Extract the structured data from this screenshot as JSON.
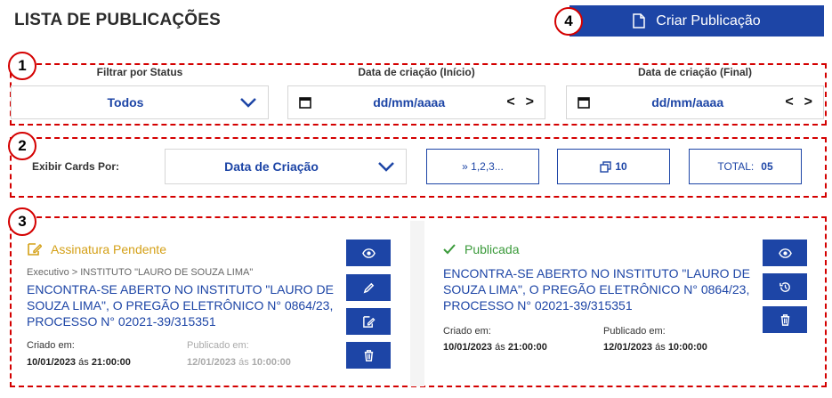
{
  "header": {
    "title": "LISTA DE PUBLICAÇÕES",
    "create_button": "Criar Publicação"
  },
  "callouts": [
    "1",
    "2",
    "3",
    "4"
  ],
  "filters": {
    "status_label": "Filtrar por Status",
    "status_value": "Todos",
    "start_label": "Data de criação (Início)",
    "start_placeholder": "dd/mm/aaaa",
    "end_label": "Data de criação (Final)",
    "end_placeholder": "dd/mm/aaaa",
    "prev_symbol": "<",
    "next_symbol": ">"
  },
  "display": {
    "label": "Exibir Cards Por:",
    "sort_value": "Data de Criação",
    "pagination_label": "» 1,2,3...",
    "per_page": "10",
    "total_label": "TOTAL:",
    "total_value": "05"
  },
  "cards": [
    {
      "status": "Assinatura Pendente",
      "status_color": "#d4a017",
      "breadcrumb": "Executivo > INSTITUTO \"LAURO DE SOUZA LIMA\"",
      "title": "ENCONTRA-SE ABERTO NO INSTITUTO \"LAURO DE SOUZA LIMA\", O PREGÃO ELETRÔNICO N° 0864/23, PROCESSO N° 02021-39/315351",
      "created_label": "Criado em:",
      "created_date": "10/01/2023",
      "created_sep": "ás",
      "created_time": "21:00:00",
      "published_label": "Publicado em:",
      "published_date": "12/01/2023",
      "published_sep": "ás",
      "published_time": "10:00:00"
    },
    {
      "status": "Publicada",
      "status_color": "#3a9a3a",
      "title": "ENCONTRA-SE ABERTO NO INSTITUTO \"LAURO DE SOUZA LIMA\", O PREGÃO ELETRÔNICO N° 0864/23, PROCESSO N° 02021-39/315351",
      "created_label": "Criado em:",
      "created_date": "10/01/2023",
      "created_sep": "ás",
      "created_time": "21:00:00",
      "published_label": "Publicado em:",
      "published_date": "12/01/2023",
      "published_sep": "ás",
      "published_time": "10:00:00"
    }
  ],
  "icons": {
    "create": "document-icon",
    "view": "eye-icon",
    "edit": "pencil-icon",
    "sign": "sign-document-icon",
    "delete": "trash-icon",
    "history": "history-icon",
    "calendar": "calendar-icon",
    "chevron": "chevron-down-icon",
    "cards": "copy-icon",
    "check": "check-icon"
  },
  "colors": {
    "primary": "#1d45a6",
    "callout": "#d40000"
  }
}
